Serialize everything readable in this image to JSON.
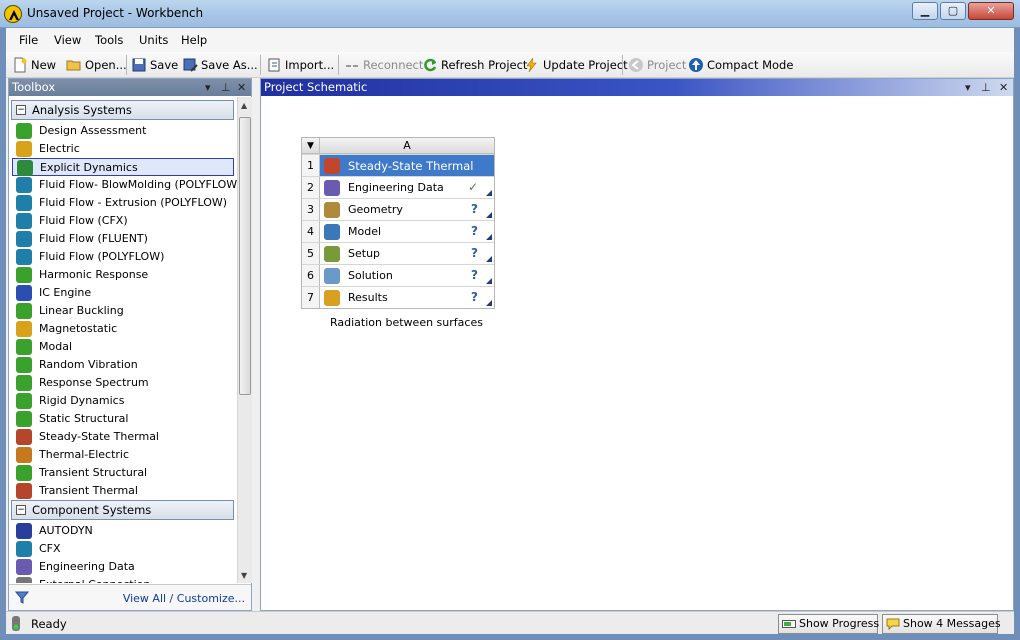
{
  "window": {
    "title": "Unsaved Project - Workbench"
  },
  "menu": [
    "File",
    "View",
    "Tools",
    "Units",
    "Help"
  ],
  "toolbar": {
    "new": "New",
    "open": "Open...",
    "save": "Save",
    "save_as": "Save As...",
    "import": "Import...",
    "reconnect": "Reconnect",
    "refresh": "Refresh Project",
    "update": "Update Project",
    "project": "Project",
    "compact": "Compact Mode"
  },
  "toolbox": {
    "title": "Toolbox",
    "analysis_group": "Analysis Systems",
    "analysis_items": [
      {
        "label": "Design Assessment",
        "icon": "design-assessment-icon",
        "color": "#3aa12d"
      },
      {
        "label": "Electric",
        "icon": "electric-icon",
        "color": "#d9a21b"
      },
      {
        "label": "Explicit Dynamics",
        "icon": "explicit-dynamics-icon",
        "color": "#2d8a3a"
      },
      {
        "label": "Fluid Flow- BlowMolding (POLYFLOW)",
        "icon": "fluid-flow-icon",
        "color": "#1f7fa8"
      },
      {
        "label": "Fluid Flow - Extrusion (POLYFLOW)",
        "icon": "fluid-flow-icon",
        "color": "#1f7fa8"
      },
      {
        "label": "Fluid Flow (CFX)",
        "icon": "fluid-flow-icon",
        "color": "#1f7fa8"
      },
      {
        "label": "Fluid Flow (FLUENT)",
        "icon": "fluid-flow-icon",
        "color": "#1f7fa8"
      },
      {
        "label": "Fluid Flow (POLYFLOW)",
        "icon": "fluid-flow-icon",
        "color": "#1f7fa8"
      },
      {
        "label": "Harmonic Response",
        "icon": "harmonic-response-icon",
        "color": "#3aa12d"
      },
      {
        "label": "IC Engine",
        "icon": "ic-engine-icon",
        "color": "#2a4fb0"
      },
      {
        "label": "Linear Buckling",
        "icon": "linear-buckling-icon",
        "color": "#3aa12d"
      },
      {
        "label": "Magnetostatic",
        "icon": "magnetostatic-icon",
        "color": "#d9a21b"
      },
      {
        "label": "Modal",
        "icon": "modal-icon",
        "color": "#3aa12d"
      },
      {
        "label": "Random Vibration",
        "icon": "random-vibration-icon",
        "color": "#3aa12d"
      },
      {
        "label": "Response Spectrum",
        "icon": "response-spectrum-icon",
        "color": "#3aa12d"
      },
      {
        "label": "Rigid Dynamics",
        "icon": "rigid-dynamics-icon",
        "color": "#3aa12d"
      },
      {
        "label": "Static Structural",
        "icon": "static-structural-icon",
        "color": "#3aa12d"
      },
      {
        "label": "Steady-State Thermal",
        "icon": "thermal-icon",
        "color": "#b4462c"
      },
      {
        "label": "Thermal-Electric",
        "icon": "thermal-electric-icon",
        "color": "#c47a1c"
      },
      {
        "label": "Transient Structural",
        "icon": "transient-structural-icon",
        "color": "#3aa12d"
      },
      {
        "label": "Transient Thermal",
        "icon": "thermal-icon",
        "color": "#b4462c"
      }
    ],
    "component_group": "Component Systems",
    "component_items": [
      {
        "label": "AUTODYN",
        "icon": "autodyn-icon",
        "color": "#2a3f9c"
      },
      {
        "label": "CFX",
        "icon": "cfx-icon",
        "color": "#1f7fa8"
      },
      {
        "label": "Engineering Data",
        "icon": "engineering-data-icon",
        "color": "#6b5bb0"
      },
      {
        "label": "External Connection",
        "icon": "external-connection-icon",
        "color": "#777777"
      }
    ],
    "footer_link": "View All / Customize..."
  },
  "schematic": {
    "title": "Project Schematic",
    "column": "A",
    "rows": [
      {
        "num": "1",
        "label": "Steady-State Thermal",
        "status": "",
        "icon": "thermal-icon"
      },
      {
        "num": "2",
        "label": "Engineering Data",
        "status": "✓",
        "icon": "engineering-data-icon"
      },
      {
        "num": "3",
        "label": "Geometry",
        "status": "?",
        "icon": "geometry-icon"
      },
      {
        "num": "4",
        "label": "Model",
        "status": "?",
        "icon": "model-icon"
      },
      {
        "num": "5",
        "label": "Setup",
        "status": "?",
        "icon": "setup-icon"
      },
      {
        "num": "6",
        "label": "Solution",
        "status": "?",
        "icon": "solution-icon"
      },
      {
        "num": "7",
        "label": "Results",
        "status": "?",
        "icon": "results-icon"
      }
    ],
    "caption": "Radiation between surfaces"
  },
  "status": {
    "text": "Ready",
    "show_progress": "Show Progress",
    "show_messages": "Show 4 Messages"
  }
}
